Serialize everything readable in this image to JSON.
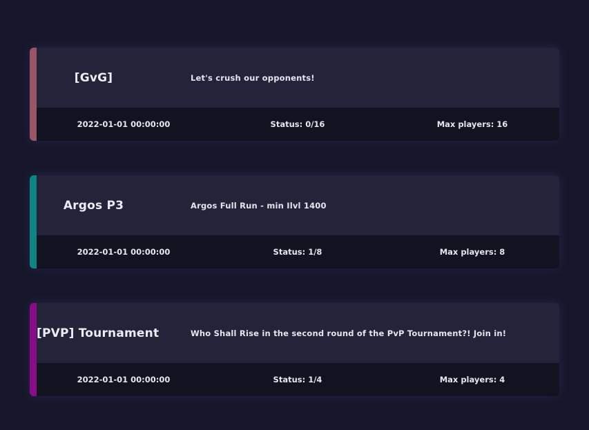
{
  "events": [
    {
      "title": "[GvG]",
      "description": "Let's crush our opponents!",
      "date": "2022-01-01 00:00:00",
      "status": "Status: 0/16",
      "max_players": "Max players: 16",
      "accent_color": "#9b5468"
    },
    {
      "title": "Argos P3",
      "description": "Argos Full Run - min Ilvl 1400",
      "date": "2022-01-01 00:00:00",
      "status": "Status: 1/8",
      "max_players": "Max players: 8",
      "accent_color": "#0e8582"
    },
    {
      "title": "[PVP] Tournament",
      "description": "Who Shall Rise in the second round of the PvP Tournament?! Join in!",
      "date": "2022-01-01 00:00:00",
      "status": "Status: 1/4",
      "max_players": "Max players: 4",
      "accent_color": "#8a0d88"
    }
  ]
}
